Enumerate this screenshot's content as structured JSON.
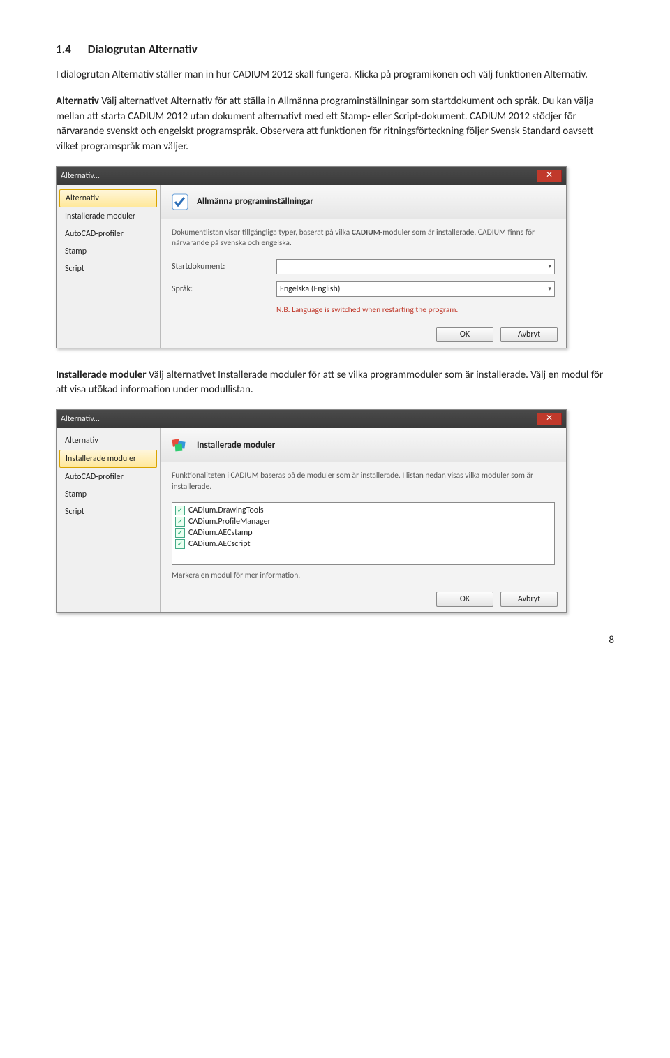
{
  "heading": {
    "num": "1.4",
    "title": "Dialogrutan Alternativ"
  },
  "intro": "I dialogrutan Alternativ ställer man in hur CADIUM 2012 skall fungera. Klicka på programikonen och välj funktionen Alternativ.",
  "para2_label": "Alternativ",
  "para2_rest": " Välj alternativet Alternativ för att ställa in Allmänna programinställningar som startdokument och språk. Du kan välja mellan att starta CADIUM 2012 utan dokument alternativt med ett Stamp- eller Script-dokument. CADIUM 2012 stödjer för närvarande svenskt och engelskt programspråk. Observera att funktionen för ritningsförteckning följer Svensk Standard oavsett vilket programspråk man väljer.",
  "dlg_title": "Alternativ...",
  "nav": {
    "i0": "Alternativ",
    "i1": "Installerade moduler",
    "i2": "AutoCAD-profiler",
    "i3": "Stamp",
    "i4": "Script"
  },
  "dlg1": {
    "header": "Allmänna programinställningar",
    "desc_a": "Dokumentlistan visar tillgängliga typer, baserat på vilka ",
    "desc_b": "CADIUM",
    "desc_c": "-moduler som är installerade. CADIUM finns för närvarande på svenska och engelska.",
    "lbl_start": "Startdokument:",
    "val_start": "",
    "lbl_lang": "Språk:",
    "val_lang": "Engelska (English)",
    "warn": "N.B. Language is switched when restarting the program."
  },
  "dlg2": {
    "header": "Installerade moduler",
    "desc": "Funktionaliteten i CADIUM baseras på de moduler som är installerade. I listan nedan visas vilka moduler som är installerade.",
    "m0": "CADium.DrawingTools",
    "m1": "CADium.ProfileManager",
    "m2": "CADium.AECstamp",
    "m3": "CADium.AECscript",
    "hint": "Markera en modul för mer information."
  },
  "btn_ok": "OK",
  "btn_cancel": "Avbryt",
  "para3_label": "Installerade moduler",
  "para3_rest": " Välj alternativet Installerade moduler för att se vilka programmoduler som är installerade. Välj en modul för att visa utökad information under modullistan.",
  "page_num": "8"
}
